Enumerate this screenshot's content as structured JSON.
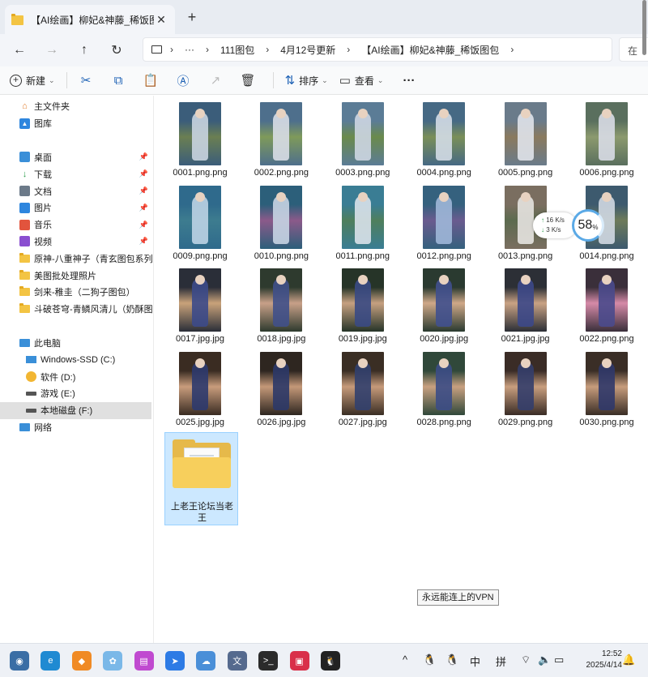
{
  "tab": {
    "title": "【AI绘画】柳妃&神藤_稀饭图包",
    "close": "✕",
    "new_tab": "+"
  },
  "nav_buttons": {
    "back": "←",
    "forward": "→",
    "up": "↑",
    "refresh": "↻"
  },
  "address": {
    "more": "···",
    "crumbs": [
      "111图包",
      "4月12号更新",
      "【AI绘画】柳妃&神藤_稀饭图包"
    ],
    "sep": "›"
  },
  "search": {
    "placeholder": "在"
  },
  "toolbar": {
    "new_label": "新建",
    "sort_label": "排序",
    "view_label": "查看",
    "more": "···"
  },
  "sidebar": {
    "top": [
      {
        "label": "主文件夹",
        "icon": "home-icon"
      },
      {
        "label": "图库",
        "icon": "gallery-icon"
      }
    ],
    "quick": [
      {
        "label": "桌面",
        "icon": "desktop-icon",
        "pinned": true
      },
      {
        "label": "下载",
        "icon": "download-icon",
        "pinned": true
      },
      {
        "label": "文档",
        "icon": "document-icon",
        "pinned": true
      },
      {
        "label": "图片",
        "icon": "pictures-icon",
        "pinned": true
      },
      {
        "label": "音乐",
        "icon": "music-icon",
        "pinned": true
      },
      {
        "label": "视频",
        "icon": "video-icon",
        "pinned": true
      },
      {
        "label": "原神-八重神子（青玄图包系列）",
        "icon": "folder-icon",
        "pinned": false
      },
      {
        "label": "美图批处理照片",
        "icon": "folder-icon",
        "pinned": false
      },
      {
        "label": "剑来-稚圭（二狗子图包）",
        "icon": "folder-icon",
        "pinned": false
      },
      {
        "label": "斗破苍穹-青鳞风清儿（奶酥图包",
        "icon": "folder-icon",
        "pinned": false
      }
    ],
    "pc_label": "此电脑",
    "drives": [
      {
        "label": "Windows-SSD (C:)",
        "icon": "windows-drive-icon"
      },
      {
        "label": "软件 (D:)",
        "icon": "drive-d-icon"
      },
      {
        "label": "游戏 (E:)",
        "icon": "drive-icon"
      },
      {
        "label": "本地磁盘 (F:)",
        "icon": "drive-icon",
        "selected": true
      }
    ],
    "network_label": "网络"
  },
  "files": [
    {
      "name": "0001.png.png",
      "palette": [
        "#3b5d7a",
        "#c9d4e0",
        "#6b7f52"
      ]
    },
    {
      "name": "0002.png.png",
      "palette": [
        "#4e6f8c",
        "#d8dde6",
        "#7f9a5a"
      ]
    },
    {
      "name": "0003.png.png",
      "palette": [
        "#5b7c96",
        "#cdd6e2",
        "#6a8a4c"
      ]
    },
    {
      "name": "0004.png.png",
      "palette": [
        "#466984",
        "#d3dbe6",
        "#7a8f58"
      ]
    },
    {
      "name": "0005.png.png",
      "palette": [
        "#6a7b8a",
        "#e0e3ea",
        "#8a7a5e"
      ]
    },
    {
      "name": "0006.png.png",
      "palette": [
        "#5a6f5e",
        "#d8dce6",
        "#8c9a6e"
      ]
    },
    {
      "name": "0009.png.png",
      "palette": [
        "#2f6a8c",
        "#bcd3e4",
        "#3d7c8f"
      ]
    },
    {
      "name": "0010.png.png",
      "palette": [
        "#2c5f7a",
        "#c7d4e3",
        "#8b5a8a"
      ]
    },
    {
      "name": "0011.png.png",
      "palette": [
        "#3a7d94",
        "#d9e2ea",
        "#4f7f5c"
      ]
    },
    {
      "name": "0012.png.png",
      "palette": [
        "#35617e",
        "#9fb7d8",
        "#6a5b8f"
      ]
    },
    {
      "name": "0013.png.png",
      "palette": [
        "#7a6e60",
        "#e6e3e0",
        "#5c6b4f"
      ]
    },
    {
      "name": "0014.png.png",
      "palette": [
        "#3d5a6e",
        "#d0d8e2",
        "#6e7b5a"
      ]
    },
    {
      "name": "0017.jpg.jpg",
      "palette": [
        "#2a2e38",
        "#3c4a8a",
        "#c9a27a"
      ]
    },
    {
      "name": "0018.jpg.jpg",
      "palette": [
        "#2e3a2e",
        "#40508a",
        "#c8a088"
      ]
    },
    {
      "name": "0019.jpg.jpg",
      "palette": [
        "#263428",
        "#3a4a84",
        "#c6a080"
      ]
    },
    {
      "name": "0020.jpg.jpg",
      "palette": [
        "#2a3a30",
        "#40508e",
        "#cfa888"
      ]
    },
    {
      "name": "0021.jpg.jpg",
      "palette": [
        "#2c2f36",
        "#3c4888",
        "#c9a284"
      ]
    },
    {
      "name": "0022.png.png",
      "palette": [
        "#3a2f3a",
        "#4a4a8c",
        "#d68aa8"
      ]
    },
    {
      "name": "0025.jpg.jpg",
      "palette": [
        "#3a2c22",
        "#2e3a6e",
        "#c89c7c"
      ]
    },
    {
      "name": "0026.jpg.jpg",
      "palette": [
        "#2e2620",
        "#2c3868",
        "#c49878"
      ]
    },
    {
      "name": "0027.jpg.jpg",
      "palette": [
        "#3a2e24",
        "#32406e",
        "#c69a7a"
      ]
    },
    {
      "name": "0028.png.png",
      "palette": [
        "#30483a",
        "#3c4c86",
        "#c8a080"
      ]
    },
    {
      "name": "0029.png.png",
      "palette": [
        "#3a2c26",
        "#343e6c",
        "#c89e7e"
      ]
    },
    {
      "name": "0030.png.png",
      "palette": [
        "#3a2e26",
        "#30386a",
        "#c69c7c"
      ]
    }
  ],
  "folder": {
    "name": "上老王论坛当老王"
  },
  "tooltip": {
    "text": "永远能连上的VPN"
  },
  "net_widget": {
    "up": "16",
    "down": "3",
    "unit": "K/s",
    "percent": "58",
    "percent_sign": "%"
  },
  "taskbar": {
    "apps": [
      {
        "name": "photos-app-icon",
        "color": "#3a6ea5",
        "glyph": "◉"
      },
      {
        "name": "edge-icon",
        "color": "#1f8ad2",
        "glyph": "e"
      },
      {
        "name": "store-app-icon",
        "color": "#f08a24",
        "glyph": "◆"
      },
      {
        "name": "colorful-app-icon",
        "color": "#7ab8e8",
        "glyph": "✿"
      },
      {
        "name": "design-app-icon",
        "color": "#c04ad0",
        "glyph": "▤"
      },
      {
        "name": "feishu-icon",
        "color": "#2d7be5",
        "glyph": "➤"
      },
      {
        "name": "cloud-app-icon",
        "color": "#4a8fd8",
        "glyph": "☁"
      },
      {
        "name": "translate-app-icon",
        "color": "#556a8e",
        "glyph": "文"
      },
      {
        "name": "terminal-icon",
        "color": "#2b2b2b",
        "glyph": ">_"
      },
      {
        "name": "red-app-icon",
        "color": "#d9304a",
        "glyph": "▣"
      },
      {
        "name": "qq-icon",
        "color": "#222222",
        "glyph": "🐧"
      }
    ],
    "tray": {
      "chevron": "^",
      "ime_lang": "中",
      "ime_mode": "拼"
    },
    "time": "12:52",
    "date": "2025/4/14"
  }
}
